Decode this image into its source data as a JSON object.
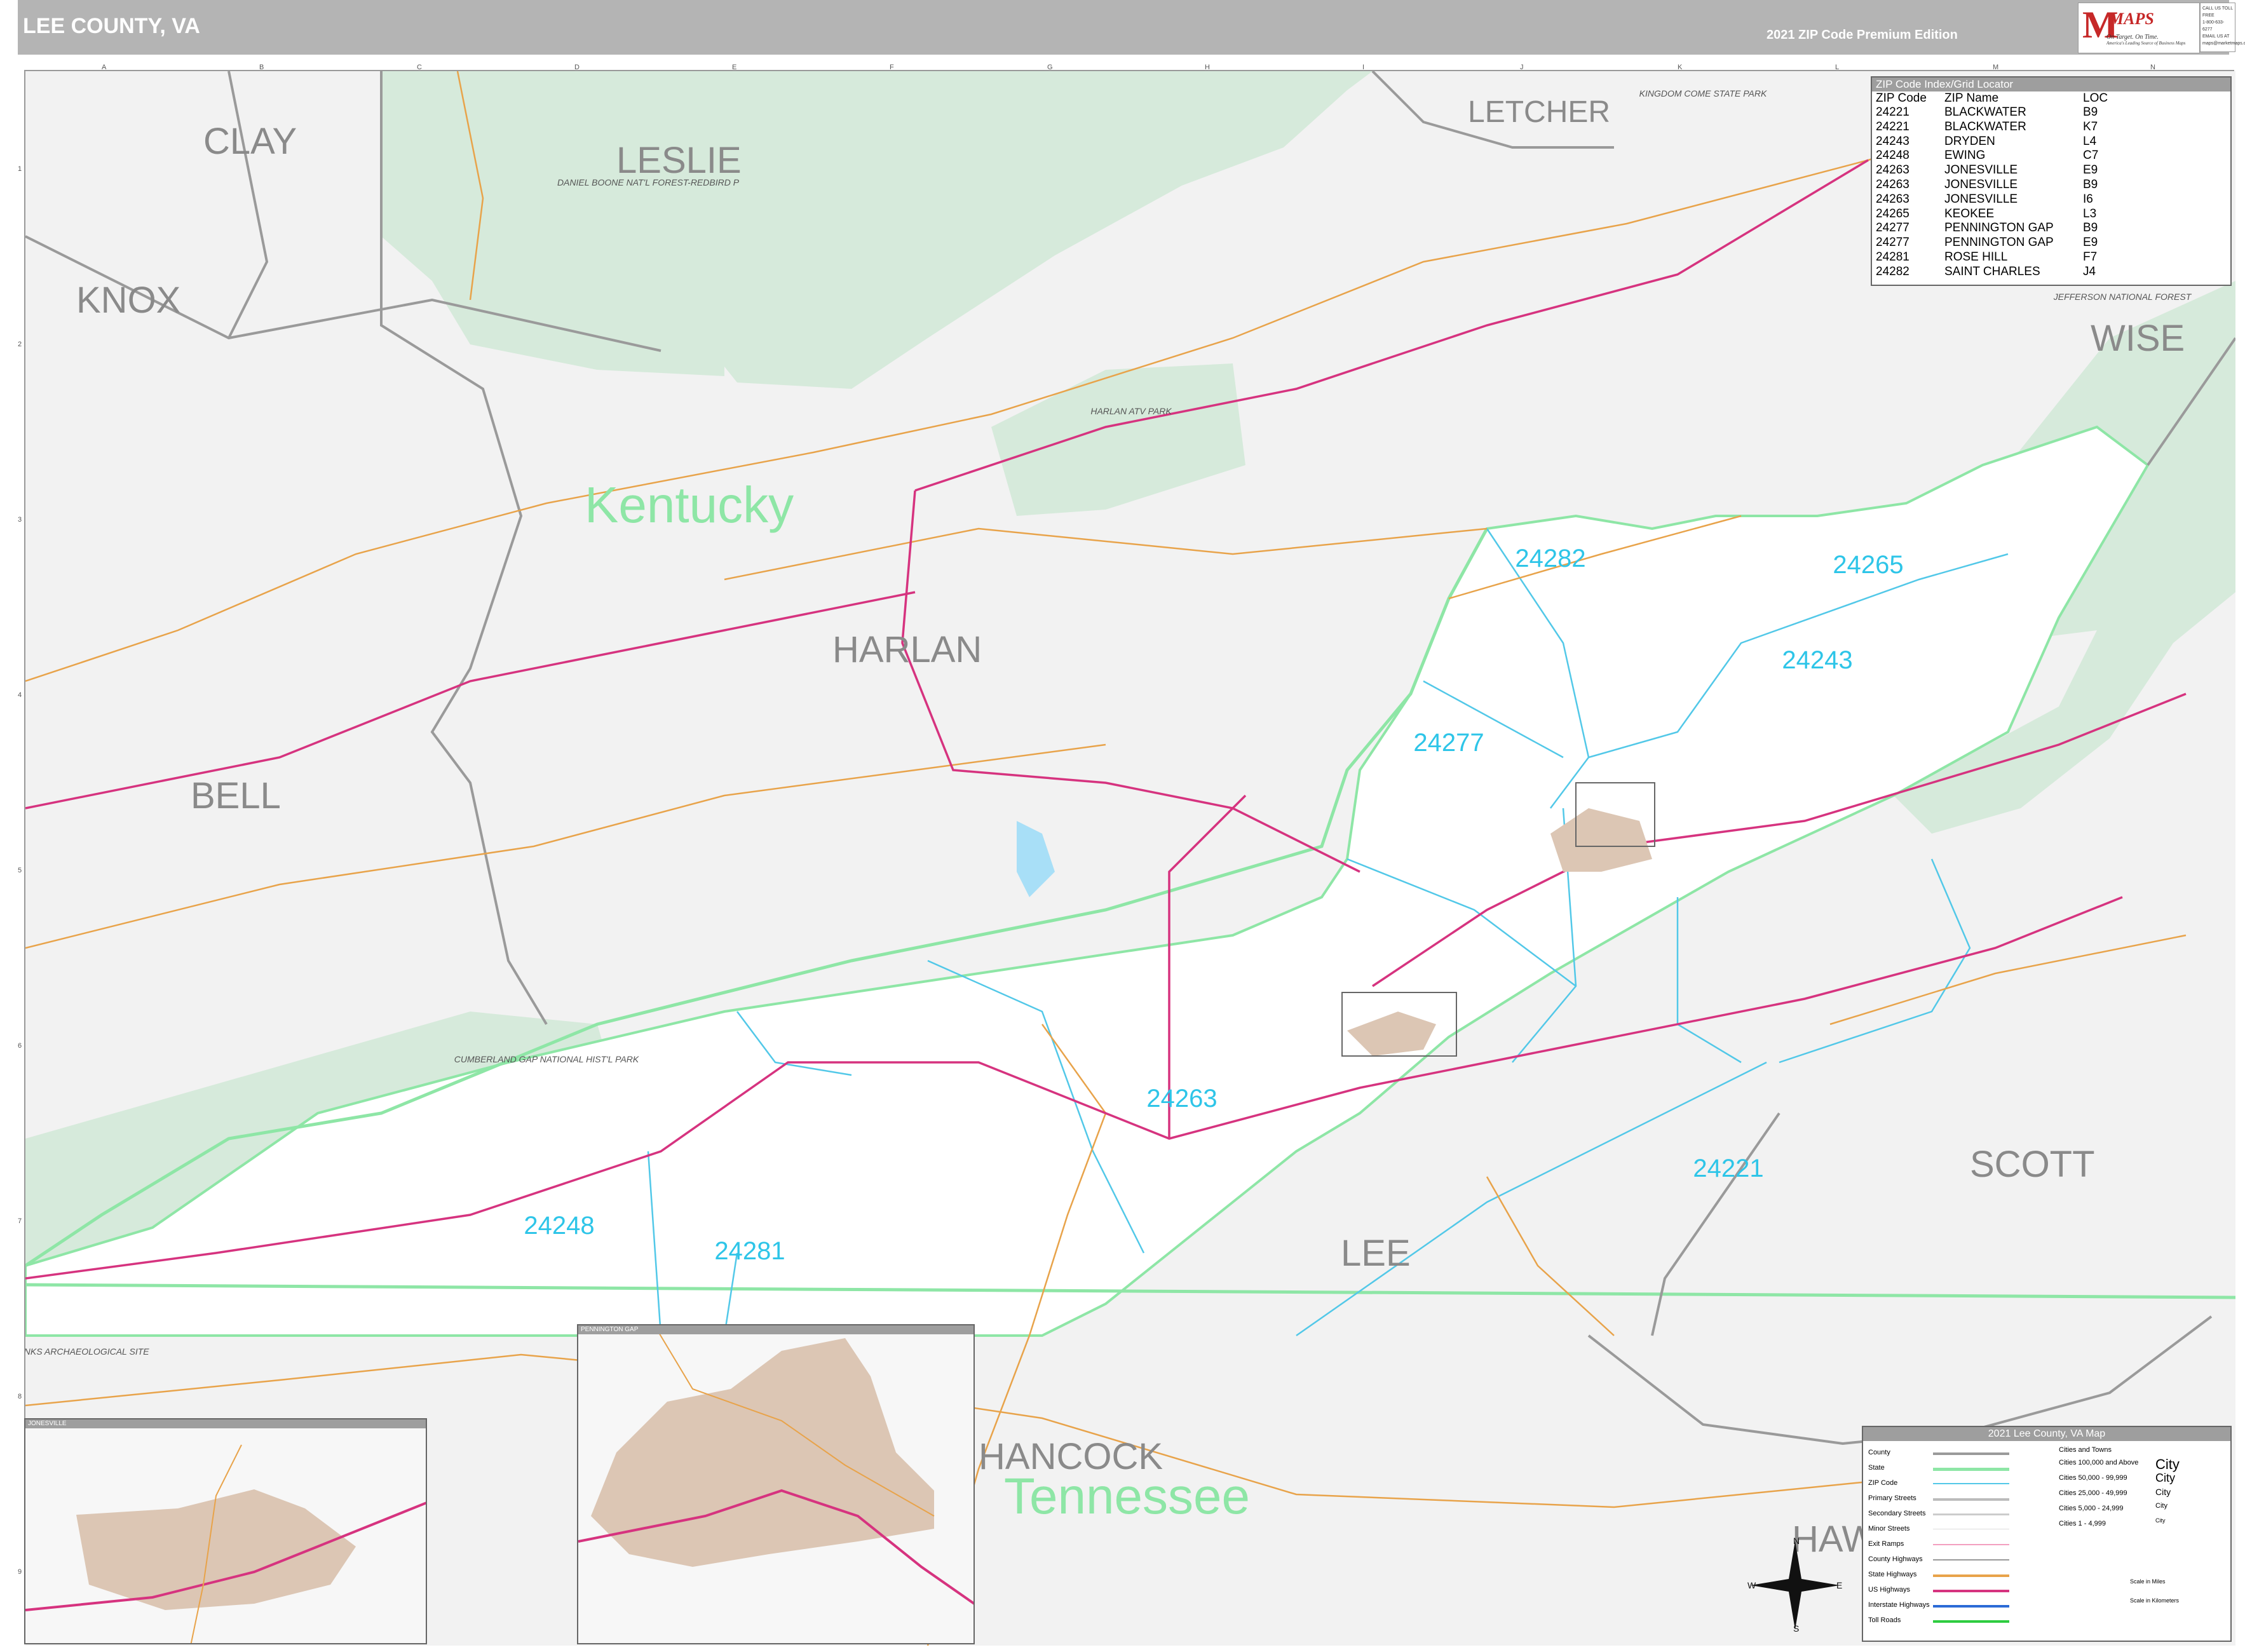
{
  "header": {
    "title": "LEE COUNTY, VA",
    "edition": "2021 ZIP Code Premium Edition",
    "logo_text": "MAPS",
    "logo_letter": "M",
    "logo_tagline": "On Target. On Time.",
    "logo_sub": "America's Leading Source of Business Maps",
    "contact_lines": [
      "CALL US TOLL FREE",
      "1-800-633-6277",
      "EMAIL US AT",
      "maps@marketmaps.com"
    ]
  },
  "grid": {
    "letters": [
      "A",
      "B",
      "C",
      "D",
      "E",
      "F",
      "G",
      "H",
      "I",
      "J",
      "K",
      "L",
      "M",
      "N"
    ],
    "numbers": [
      "1",
      "2",
      "3",
      "4",
      "5",
      "6",
      "7",
      "8",
      "9"
    ]
  },
  "map_labels": {
    "counties": [
      "CLAY",
      "LESLIE",
      "LETCHER",
      "KNOX",
      "WISE",
      "HARLAN",
      "BELL",
      "SCOTT",
      "LEE",
      "HANCOCK",
      "HAW"
    ],
    "states": [
      "Kentucky",
      "Tennessee"
    ],
    "parks": [
      "DANIEL BOONE NAT'L FOREST-REDBIRD P",
      "HARLAN ATV PARK",
      "CUMBERLAND GAP NATIONAL HIST'L PARK",
      "JEFFERSON NATIONAL FOREST",
      "KINGDOM COME STATE PARK",
      "GREEN BANKS ARCHAEOLOGICAL SITE"
    ],
    "zips_on_map": [
      "24282",
      "24265",
      "24243",
      "24277",
      "24263",
      "24221",
      "24248",
      "24281"
    ]
  },
  "zip_index": {
    "title": "ZIP Code Index/Grid Locator",
    "columns": [
      "ZIP Code",
      "ZIP Name",
      "LOC"
    ],
    "rows": [
      [
        "24221",
        "BLACKWATER",
        "B9"
      ],
      [
        "24221",
        "BLACKWATER",
        "K7"
      ],
      [
        "24243",
        "DRYDEN",
        "L4"
      ],
      [
        "24248",
        "EWING",
        "C7"
      ],
      [
        "24263",
        "JONESVILLE",
        "E9"
      ],
      [
        "24263",
        "JONESVILLE",
        "B9"
      ],
      [
        "24263",
        "JONESVILLE",
        "I6"
      ],
      [
        "24265",
        "KEOKEE",
        "L3"
      ],
      [
        "24277",
        "PENNINGTON GAP",
        "B9"
      ],
      [
        "24277",
        "PENNINGTON GAP",
        "E9"
      ],
      [
        "24281",
        "ROSE HILL",
        "F7"
      ],
      [
        "24282",
        "SAINT CHARLES",
        "J4"
      ]
    ]
  },
  "legend": {
    "title": "2021 Lee County, VA Map",
    "items": [
      "County",
      "State",
      "ZIP Code",
      "Primary Streets",
      "Secondary Streets",
      "Minor Streets",
      "Exit Ramps",
      "County Highways",
      "State Highways",
      "US Highways",
      "Interstate Highways",
      "Toll Roads"
    ],
    "cities_header": "Cities and Towns",
    "city_classes": [
      "Cities 100,000 and Above",
      "Cities 50,000 - 99,999",
      "Cities 25,000 - 49,999",
      "Cities 5,000 - 24,999",
      "Cities 1 - 4,999"
    ],
    "city_samples": [
      "City",
      "City",
      "City",
      "City",
      "City"
    ],
    "scale_miles": "Scale in Miles",
    "scale_km": "Scale in Kilometers"
  },
  "insets": {
    "jonesville": "JONESVILLE",
    "pennington_gap": "PENNINGTON GAP"
  },
  "compass": {
    "n": "N",
    "s": "S",
    "e": "E",
    "w": "W"
  },
  "colors": {
    "header": "#b4b4b4",
    "land": "#f2f2f2",
    "lee_county": "#ffffff",
    "forest": "#d6eadb",
    "state_line": "#8ee6a6",
    "zip_label": "#2ec5e8",
    "zip_line": "#52c8e8",
    "county_line": "#9a9a9a",
    "us_highway": "#d6337f",
    "state_highway": "#e8a34a",
    "city_area": "#dcc6b4"
  }
}
